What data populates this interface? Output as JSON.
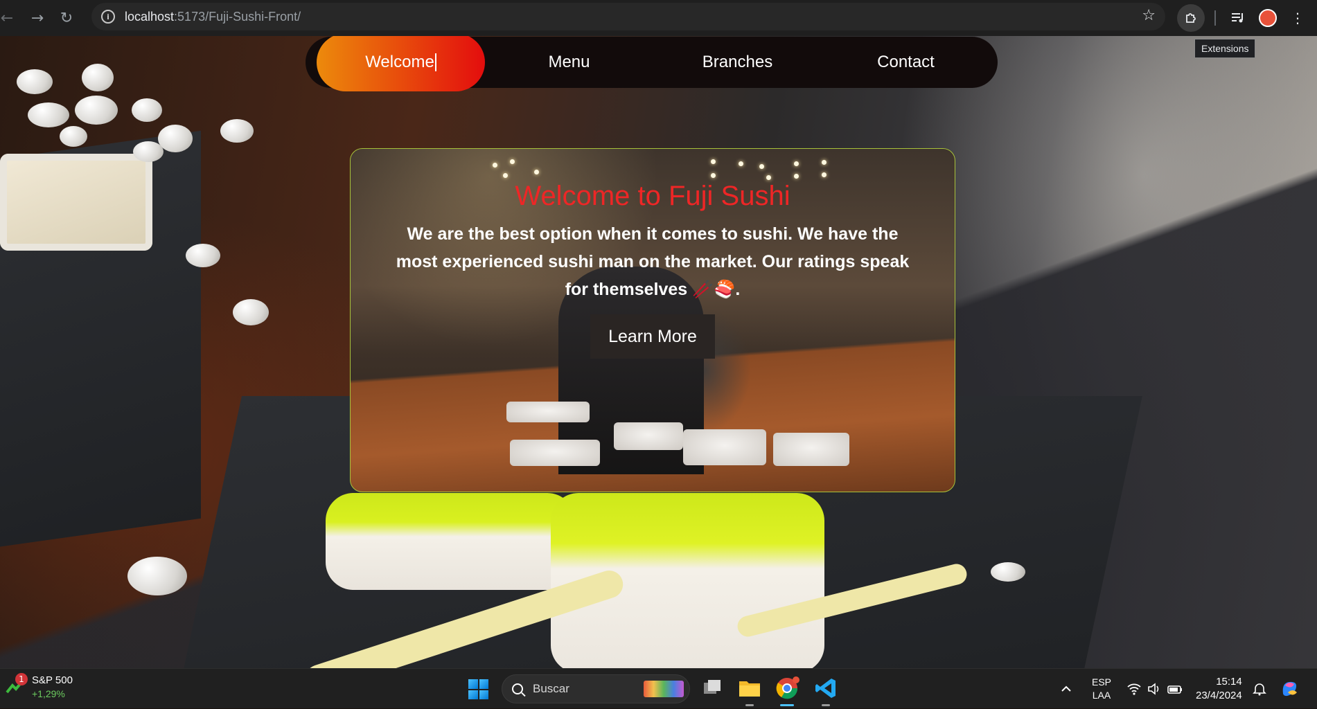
{
  "browser": {
    "url_host": "localhost",
    "url_path": ":5173/Fuji-Sushi-Front/",
    "tooltip": "Extensions",
    "icons": [
      "back-arrow-icon",
      "forward-arrow-icon",
      "reload-icon",
      "site-info-icon",
      "bookmark-star-icon",
      "extensions-puzzle-icon",
      "media-controls-icon",
      "profile-avatar-icon",
      "menu-dots-icon"
    ]
  },
  "nav": {
    "items": [
      "Welcome",
      "Menu",
      "Branches",
      "Contact"
    ],
    "active_index": 0
  },
  "hero": {
    "title": "Welcome to Fuji Sushi",
    "text_line1": "We are the best option when it comes to sushi. We have the",
    "text_line2": "most experienced sushi man on the market. Our ratings speak",
    "text_line3": "for themselves",
    "emoji": " 🥢🍣.",
    "button": "Learn More",
    "title_color": "#ee2626",
    "accent_gradient": [
      "#ec8a0c",
      "#e30d0d"
    ]
  },
  "taskbar": {
    "stock_badge": "1",
    "stock_name": "S&P 500",
    "stock_change": "+1,29%",
    "search_placeholder": "Buscar",
    "lang_1": "ESP",
    "lang_2": "LAA",
    "time": "15:14",
    "date": "23/4/2024",
    "icons": [
      "windows-start-icon",
      "search-icon",
      "task-view-icon",
      "file-explorer-icon",
      "chrome-icon",
      "vscode-icon",
      "tray-chevron-icon",
      "wifi-icon",
      "volume-icon",
      "battery-icon",
      "notification-icon",
      "copilot-icon"
    ]
  }
}
